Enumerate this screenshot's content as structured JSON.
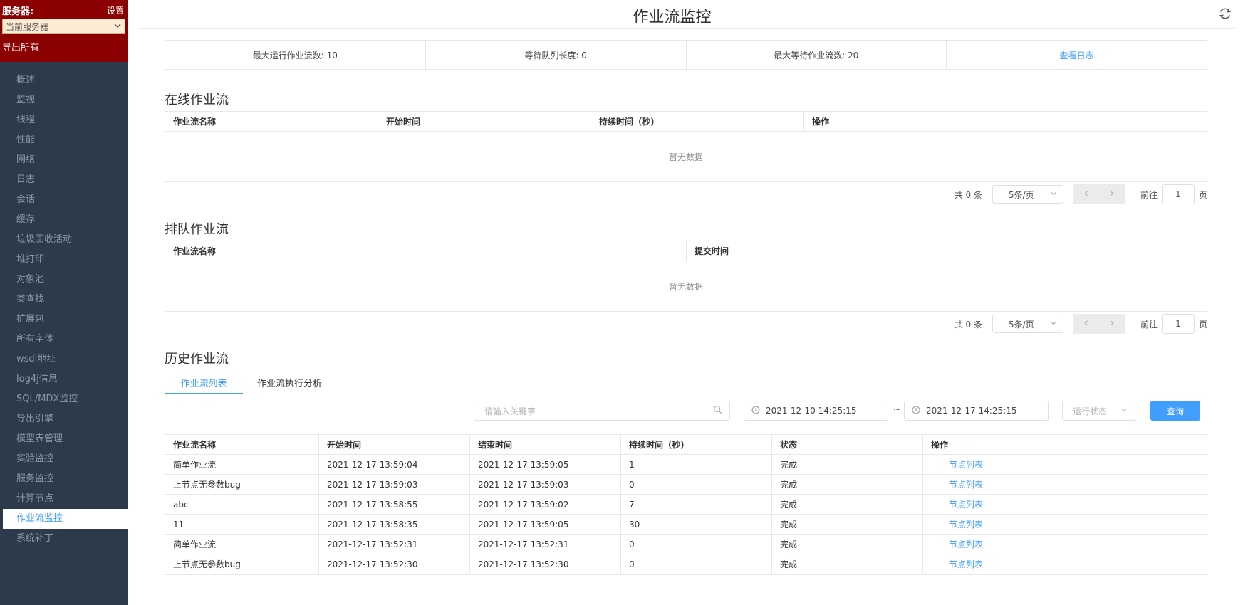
{
  "sidebar": {
    "server_label": "服务器:",
    "settings_label": "设置",
    "server_select": "当前服务器",
    "export_all": "导出所有",
    "items": [
      "概述",
      "监视",
      "线程",
      "性能",
      "网络",
      "日志",
      "会话",
      "缓存",
      "垃圾回收活动",
      "堆打印",
      "对象池",
      "类查找",
      "扩展包",
      "所有字体",
      "wsdl地址",
      "log4j信息",
      "SQL/MDX监控",
      "导出引擎",
      "模型表管理",
      "实验监控",
      "服务监控",
      "计算节点",
      "作业流监控",
      "系统补丁"
    ],
    "active_item": "作业流监控"
  },
  "header": {
    "title": "作业流监控"
  },
  "stats": {
    "max_running": "最大运行作业流数: 10",
    "queue_length": "等待队列长度: 0",
    "max_waiting": "最大等待作业流数: 20",
    "view_log": "查看日志"
  },
  "online": {
    "title": "在线作业流",
    "columns": [
      "作业流名称",
      "开始时间",
      "持续时间（秒)",
      "操作"
    ],
    "empty": "暂无数据"
  },
  "queue": {
    "title": "排队作业流",
    "columns": [
      "作业流名称",
      "提交时间"
    ],
    "empty": "暂无数据"
  },
  "pager": {
    "total": "共 0 条",
    "page_size": "5条/页",
    "goto": "前往",
    "page": "1",
    "page_unit": "页"
  },
  "history": {
    "title": "历史作业流",
    "tabs": [
      "作业流列表",
      "作业流执行分析"
    ],
    "search_placeholder": "请输入关键字",
    "start_date": "2021-12-10 14:25:15",
    "tilde": "~",
    "end_date": "2021-12-17 14:25:15",
    "status_placeholder": "运行状态",
    "query_button": "查询",
    "columns": [
      "作业流名称",
      "开始时间",
      "结束时间",
      "持续时间（秒)",
      "状态",
      "操作"
    ],
    "rows": [
      {
        "name": "简单作业流",
        "start": "2021-12-17 13:59:04",
        "end": "2021-12-17 13:59:05",
        "duration": "1",
        "status": "完成",
        "action": "节点列表"
      },
      {
        "name": "上节点无参数bug",
        "start": "2021-12-17 13:59:03",
        "end": "2021-12-17 13:59:03",
        "duration": "0",
        "status": "完成",
        "action": "节点列表"
      },
      {
        "name": "abc",
        "start": "2021-12-17 13:58:55",
        "end": "2021-12-17 13:59:02",
        "duration": "7",
        "status": "完成",
        "action": "节点列表"
      },
      {
        "name": "11",
        "start": "2021-12-17 13:58:35",
        "end": "2021-12-17 13:59:05",
        "duration": "30",
        "status": "完成",
        "action": "节点列表"
      },
      {
        "name": "简单作业流",
        "start": "2021-12-17 13:52:31",
        "end": "2021-12-17 13:52:31",
        "duration": "0",
        "status": "完成",
        "action": "节点列表"
      },
      {
        "name": "上节点无参数bug",
        "start": "2021-12-17 13:52:30",
        "end": "2021-12-17 13:52:30",
        "duration": "0",
        "status": "完成",
        "action": "节点列表"
      }
    ]
  },
  "colors": {
    "sidebar_bg": "#2d3a4b",
    "header_bg": "#8b0000",
    "accent": "#409eff"
  }
}
